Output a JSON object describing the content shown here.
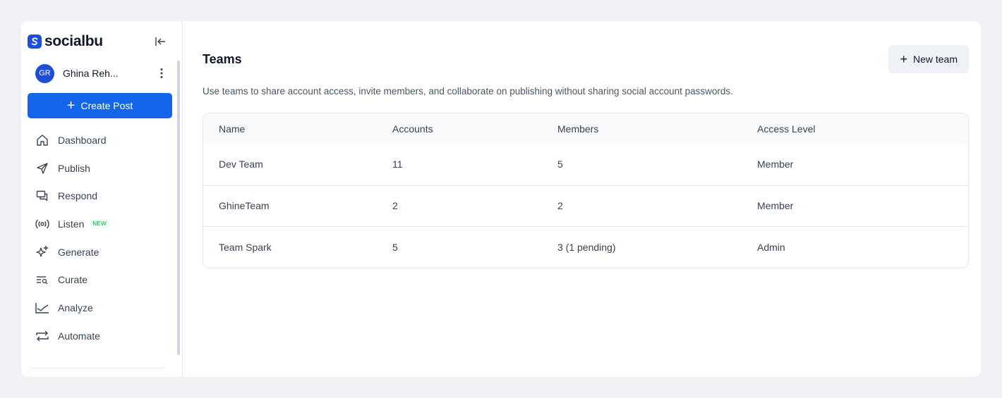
{
  "sidebar": {
    "brand": "socialbu",
    "user": {
      "initials": "GR",
      "name": "Ghina Reh..."
    },
    "create_label": "Create Post",
    "items": [
      {
        "label": "Dashboard",
        "icon": "home-icon"
      },
      {
        "label": "Publish",
        "icon": "send-icon"
      },
      {
        "label": "Respond",
        "icon": "chat-icon"
      },
      {
        "label": "Listen",
        "icon": "broadcast-icon",
        "badge": "NEW"
      },
      {
        "label": "Generate",
        "icon": "sparkle-icon"
      },
      {
        "label": "Curate",
        "icon": "filter-search-icon"
      },
      {
        "label": "Analyze",
        "icon": "chart-line-icon"
      },
      {
        "label": "Automate",
        "icon": "repeat-icon"
      }
    ]
  },
  "main": {
    "title": "Teams",
    "new_team_label": "New team",
    "description": "Use teams to share account access, invite members, and collaborate on publishing without sharing social account passwords.",
    "table": {
      "headers": [
        "Name",
        "Accounts",
        "Members",
        "Access Level"
      ],
      "rows": [
        [
          "Dev Team",
          "11",
          "5",
          "Member"
        ],
        [
          "GhineTeam",
          "2",
          "2",
          "Member"
        ],
        [
          "Team Spark",
          "5",
          "3 (1 pending)",
          "Admin"
        ]
      ]
    }
  },
  "colors": {
    "accent": "#1366ec",
    "brand": "#1d4ed8",
    "new_badge": "#16a34a"
  }
}
